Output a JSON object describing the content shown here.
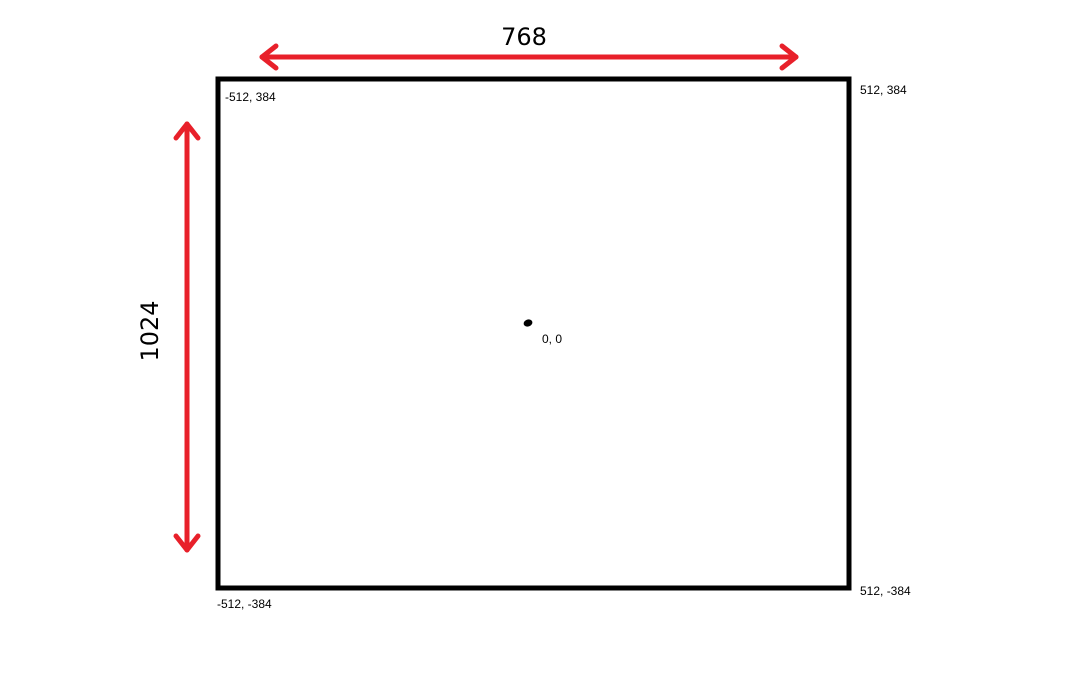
{
  "colors": {
    "frame": "#000000",
    "arrow": "#e8202a",
    "background": "#ffffff"
  },
  "dimensions": {
    "top_label": "768",
    "left_label": "1024"
  },
  "corners": {
    "top_left": "-512, 384",
    "top_right": "512, 384",
    "bottom_left": "-512, -384",
    "bottom_right": "512, -384"
  },
  "center": {
    "label": "0, 0"
  }
}
